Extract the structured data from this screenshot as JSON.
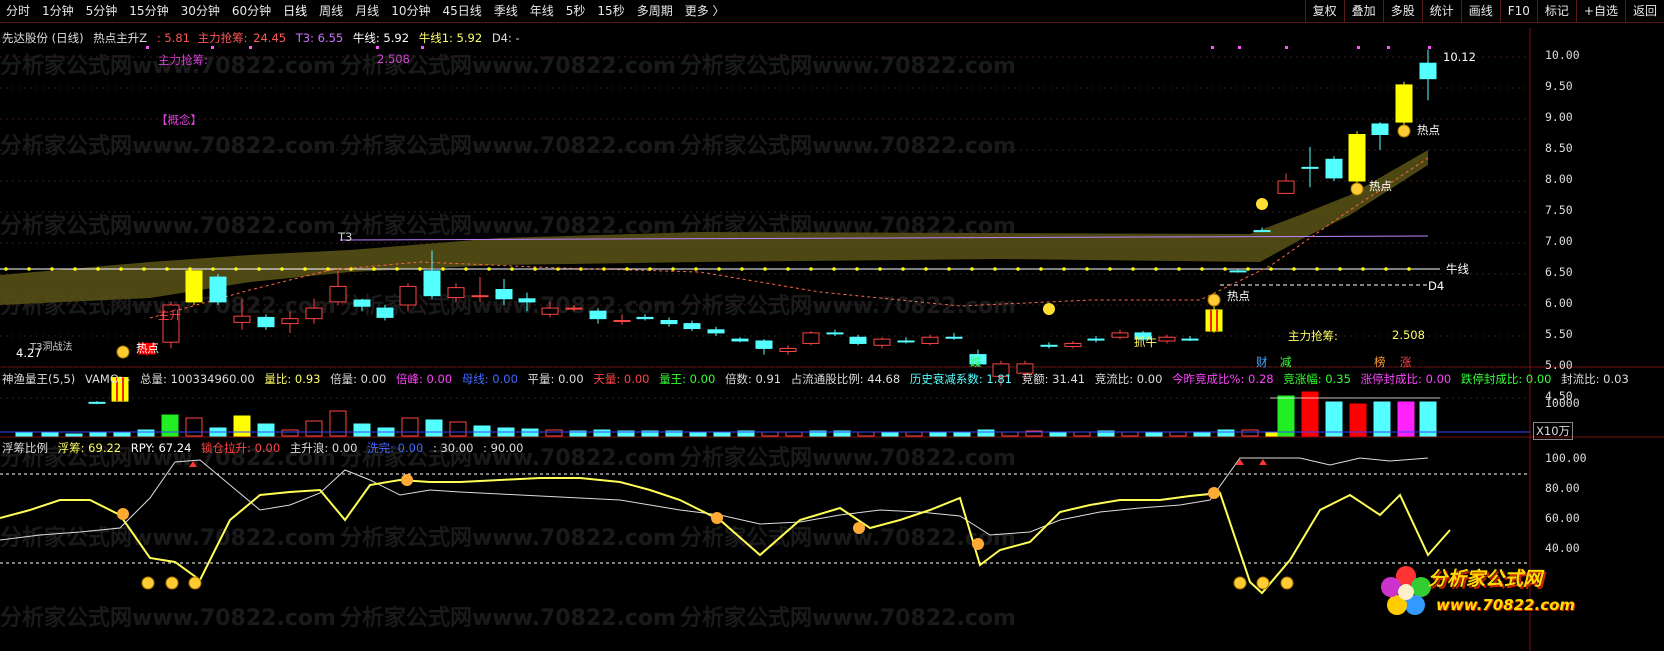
{
  "toolbar": {
    "periods": [
      "分时",
      "1分钟",
      "5分钟",
      "15分钟",
      "30分钟",
      "60分钟",
      "日线",
      "周线",
      "月线",
      "10分钟",
      "45日线",
      "季线",
      "年线",
      "5秒",
      "15秒",
      "多周期",
      "更多 〉"
    ],
    "active_period": "日线",
    "right_buttons": [
      "复权",
      "叠加",
      "多股",
      "统计",
      "画线",
      "F10",
      "标记",
      "+自选",
      "返回"
    ]
  },
  "main_info": {
    "stock": "先达股份 (日线)",
    "indicator": "热点主升Z",
    "v1": ": 5.81",
    "main_label": "主力抢筹:",
    "main_val": "24.45",
    "t3": "T3: 6.55",
    "niuxian": "牛线: 5.92",
    "niuxian1": "牛线1: 5.92",
    "d4": "D4: -",
    "main_grab_label": "主力抢筹:",
    "main_grab_val": "2.508",
    "concept": "【概念】"
  },
  "price_axis": [
    "10.00",
    "9.50",
    "9.00",
    "8.50",
    "8.00",
    "7.50",
    "7.00",
    "6.50",
    "6.00",
    "5.50",
    "5.00",
    "4.50"
  ],
  "chart_labels": {
    "high": "10.12",
    "low": "4.27",
    "hot1": "热点",
    "hot2": "热点",
    "hot3": "热点",
    "hot4": "热点",
    "rise": "主升",
    "t3": "T3",
    "niu": "牛线",
    "d4": "D4",
    "catch": "抓牛",
    "grab_label": "主力抢筹:",
    "grab_val": "2.508",
    "tag_die": "跌",
    "tag_cai": "财",
    "tag_jian": "减",
    "tag_bang": "榜",
    "tag_zhang": "涨",
    "low_tag": "T3洞战法"
  },
  "vol_info": {
    "name": "神渔量王(5,5)",
    "vamo": "VAMO: -",
    "total": "总量: 100334960.00",
    "ratio": "量比: 0.93",
    "double": "倍量: 0.00",
    "peak": "倍峰: 0.00",
    "mother": "母线: 0.00",
    "flat": "平量: 0.00",
    "sky": "天量: 0.00",
    "king": "量王: 0.00",
    "times": "倍数: 0.91",
    "float_ratio": "占流通股比例: 44.68",
    "decay": "历史衰减系数: 1.81",
    "bid": "竞额: 31.41",
    "bid_flow": "竞流比: 0.00",
    "today_bid": "今昨竞成比%: 0.28",
    "bid_amp": "竞涨幅: 0.35",
    "limit_up": "涨停封成比: 0.00",
    "limit_down": "跌停封成比: 0.00",
    "seal": "封流比: 0.03",
    "axis_val": "10000",
    "unit": "X10万"
  },
  "float_info": {
    "name": "浮筹比例",
    "fc": "浮筹: 69.22",
    "rpy": "RPY: 67.24",
    "lock": "锁仓拉升: 0.00",
    "rise": "主升浪: 0.00",
    "wash": "洗完: 0.00",
    "l30": ": 30.00",
    "l90": ": 90.00",
    "axis": [
      "100.00",
      "80.00",
      "60.00",
      "40.00"
    ]
  },
  "watermark": "分析家公式网www.70822.com",
  "logo": {
    "name": "分析家公式网",
    "url": "www.70822.com"
  },
  "colors": {
    "up": "#ff4444",
    "down": "#54ffff",
    "yellow": "#ffff00",
    "border": "#7a1010",
    "band": "#5a5418"
  }
}
